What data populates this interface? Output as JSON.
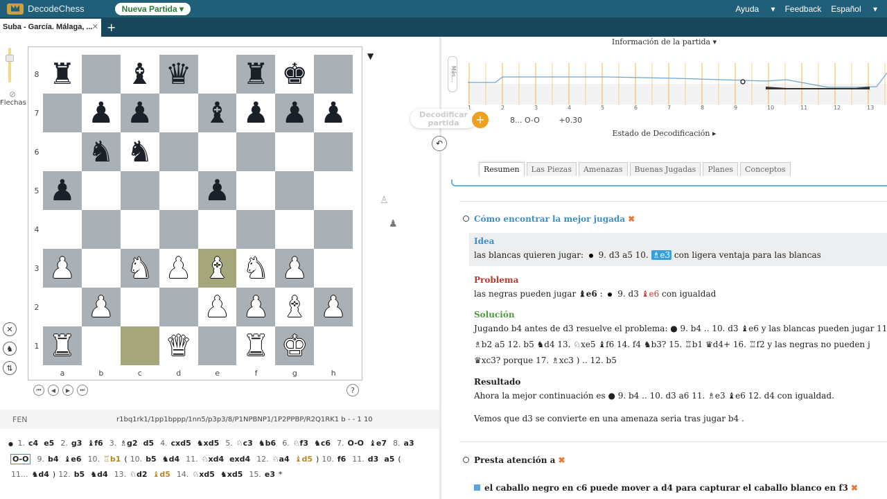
{
  "topbar": {
    "app_name": "DecodeChess",
    "new_game": "Nueva Partida",
    "help": "Ayuda",
    "feedback": "Feedback",
    "language": "Español"
  },
  "tab": {
    "title": "Suba - García. Málaga, ..."
  },
  "board": {
    "arrows_label": "Flechas",
    "ranks": [
      "8",
      "7",
      "6",
      "5",
      "4",
      "3",
      "2",
      "1"
    ],
    "files": [
      "a",
      "b",
      "c",
      "d",
      "e",
      "f",
      "g",
      "h"
    ],
    "squares": [
      [
        "♜",
        "",
        "♝",
        "♛",
        "",
        "♜",
        "♚",
        ""
      ],
      [
        "",
        "♟",
        "♟",
        "",
        "♝",
        "♟",
        "♟",
        "♟"
      ],
      [
        "",
        "♞",
        "♞",
        "",
        "",
        "",
        "",
        ""
      ],
      [
        "♟",
        "",
        "",
        "",
        "♟",
        "",
        "",
        ""
      ],
      [
        "",
        "",
        "",
        "",
        "",
        "",
        "",
        ""
      ],
      [
        "♙",
        "",
        "♘",
        "♙",
        "♗",
        "♘",
        "♙",
        ""
      ],
      [
        "",
        "♙",
        "",
        "",
        "♙",
        "♙",
        "♗",
        "♙"
      ],
      [
        "♖",
        "",
        "",
        "♕",
        "",
        "♖",
        "♔",
        ""
      ]
    ],
    "highlight": [
      "e3",
      "c1"
    ]
  },
  "fen": {
    "label": "FEN",
    "value": "r1bq1rk1/1pp1bppp/1nn5/p3p3/8/P1NPBNP1/1P2PPBP/R2Q1RK1 b - - 1 10"
  },
  "moves_text": {
    "line1": [
      "1.",
      "c4",
      "e5",
      "2.",
      "g3",
      "♝f6",
      "3.",
      "♗g2",
      "d5",
      "4.",
      "cxd5",
      "♞xd5",
      "5.",
      "♘c3",
      "♞b6",
      "6.",
      "♘f3",
      "♞c6",
      "7.",
      "O-O",
      "♝e7",
      "8.",
      "a3"
    ],
    "line2": [
      "O-O",
      "9.",
      "b4",
      "♝e6",
      "10.",
      "♖b1",
      "(",
      "10.",
      "b5",
      "♞d4",
      "11.",
      "♘xd4",
      "exd4",
      "12.",
      "♘a4",
      "♝d5",
      ")",
      "10.",
      "f6",
      "11.",
      "d3",
      "a5",
      "("
    ],
    "line3": [
      "11...",
      "♞d4",
      ")",
      "12.",
      "b5",
      "♞d4",
      "13.",
      "♘d2",
      "♝d5",
      "14.",
      "♘xd5",
      "♞xd5",
      "15.",
      "e3",
      "*"
    ]
  },
  "right": {
    "info_title": "Información de la partida ▾",
    "graph_label": "Más...",
    "move_numbers": [
      "1",
      "2",
      "3",
      "4",
      "5",
      "6",
      "7",
      "8",
      "9",
      "10",
      "11",
      "12",
      "13"
    ],
    "decode_button": "Decodificar partida",
    "eval_move": "8... O-O",
    "eval_value": "+0.30",
    "decode_state": "Estado de Decodificación ▸",
    "subtabs": [
      "Resumen",
      "Las Piezas",
      "Amenazas",
      "Buenas Jugadas",
      "Planes",
      "Conceptos"
    ]
  },
  "summary": {
    "best_move_title": "Cómo encontrar la mejor jugada",
    "idea_title": "Idea",
    "idea_text_a": "las blancas quieren jugar:",
    "idea_moves": "9. d3  a5  10.",
    "idea_hl": "♗e3",
    "idea_text_b": "con ligera ventaja para las blancas",
    "problem_title": "Problema",
    "problem_text_a": "las negras pueden jugar",
    "problem_move": "♝e6",
    "problem_text_b": "9. d3",
    "problem_hl": "♝e6",
    "problem_text_c": "con igualdad",
    "solution_title": "Solución",
    "solution_l1": "Jugando b4 antes de d3 resuelve el problema: ● 9. b4 .. 10. d3 ♝e6 y las blancas pueden jugar 11.",
    "solution_l2": "♗b2  a5  12. b5 ♞d4 13. ♘xe5 ♝f6 14. f4 ♞b3? 15. ♖b1 ♛d4+ 16. ♖f2  y las negras no pueden j",
    "solution_l3": "♛xc3?  porque 17. ♗xc3 ) .. 12. b5",
    "result_title": "Resultado",
    "result_text": "Ahora la mejor continuación es ● 9. b4 .. 10. d3  a6  11. ♗e3 ♝e6 12. d4 con igualdad.",
    "conclusion_text": "Vemos que d3 se convierte en una amenaza seria tras jugar b4 .",
    "attention_title": "Presta atención a",
    "attention_item": "el caballo negro en c6 puede mover a d4 para capturar el caballo blanco en f3"
  },
  "colors": {
    "topbar": "#1f5f7a",
    "accent": "#f0a020",
    "board_dark": "#a9b1b7",
    "highlight": "#a6a67d"
  }
}
